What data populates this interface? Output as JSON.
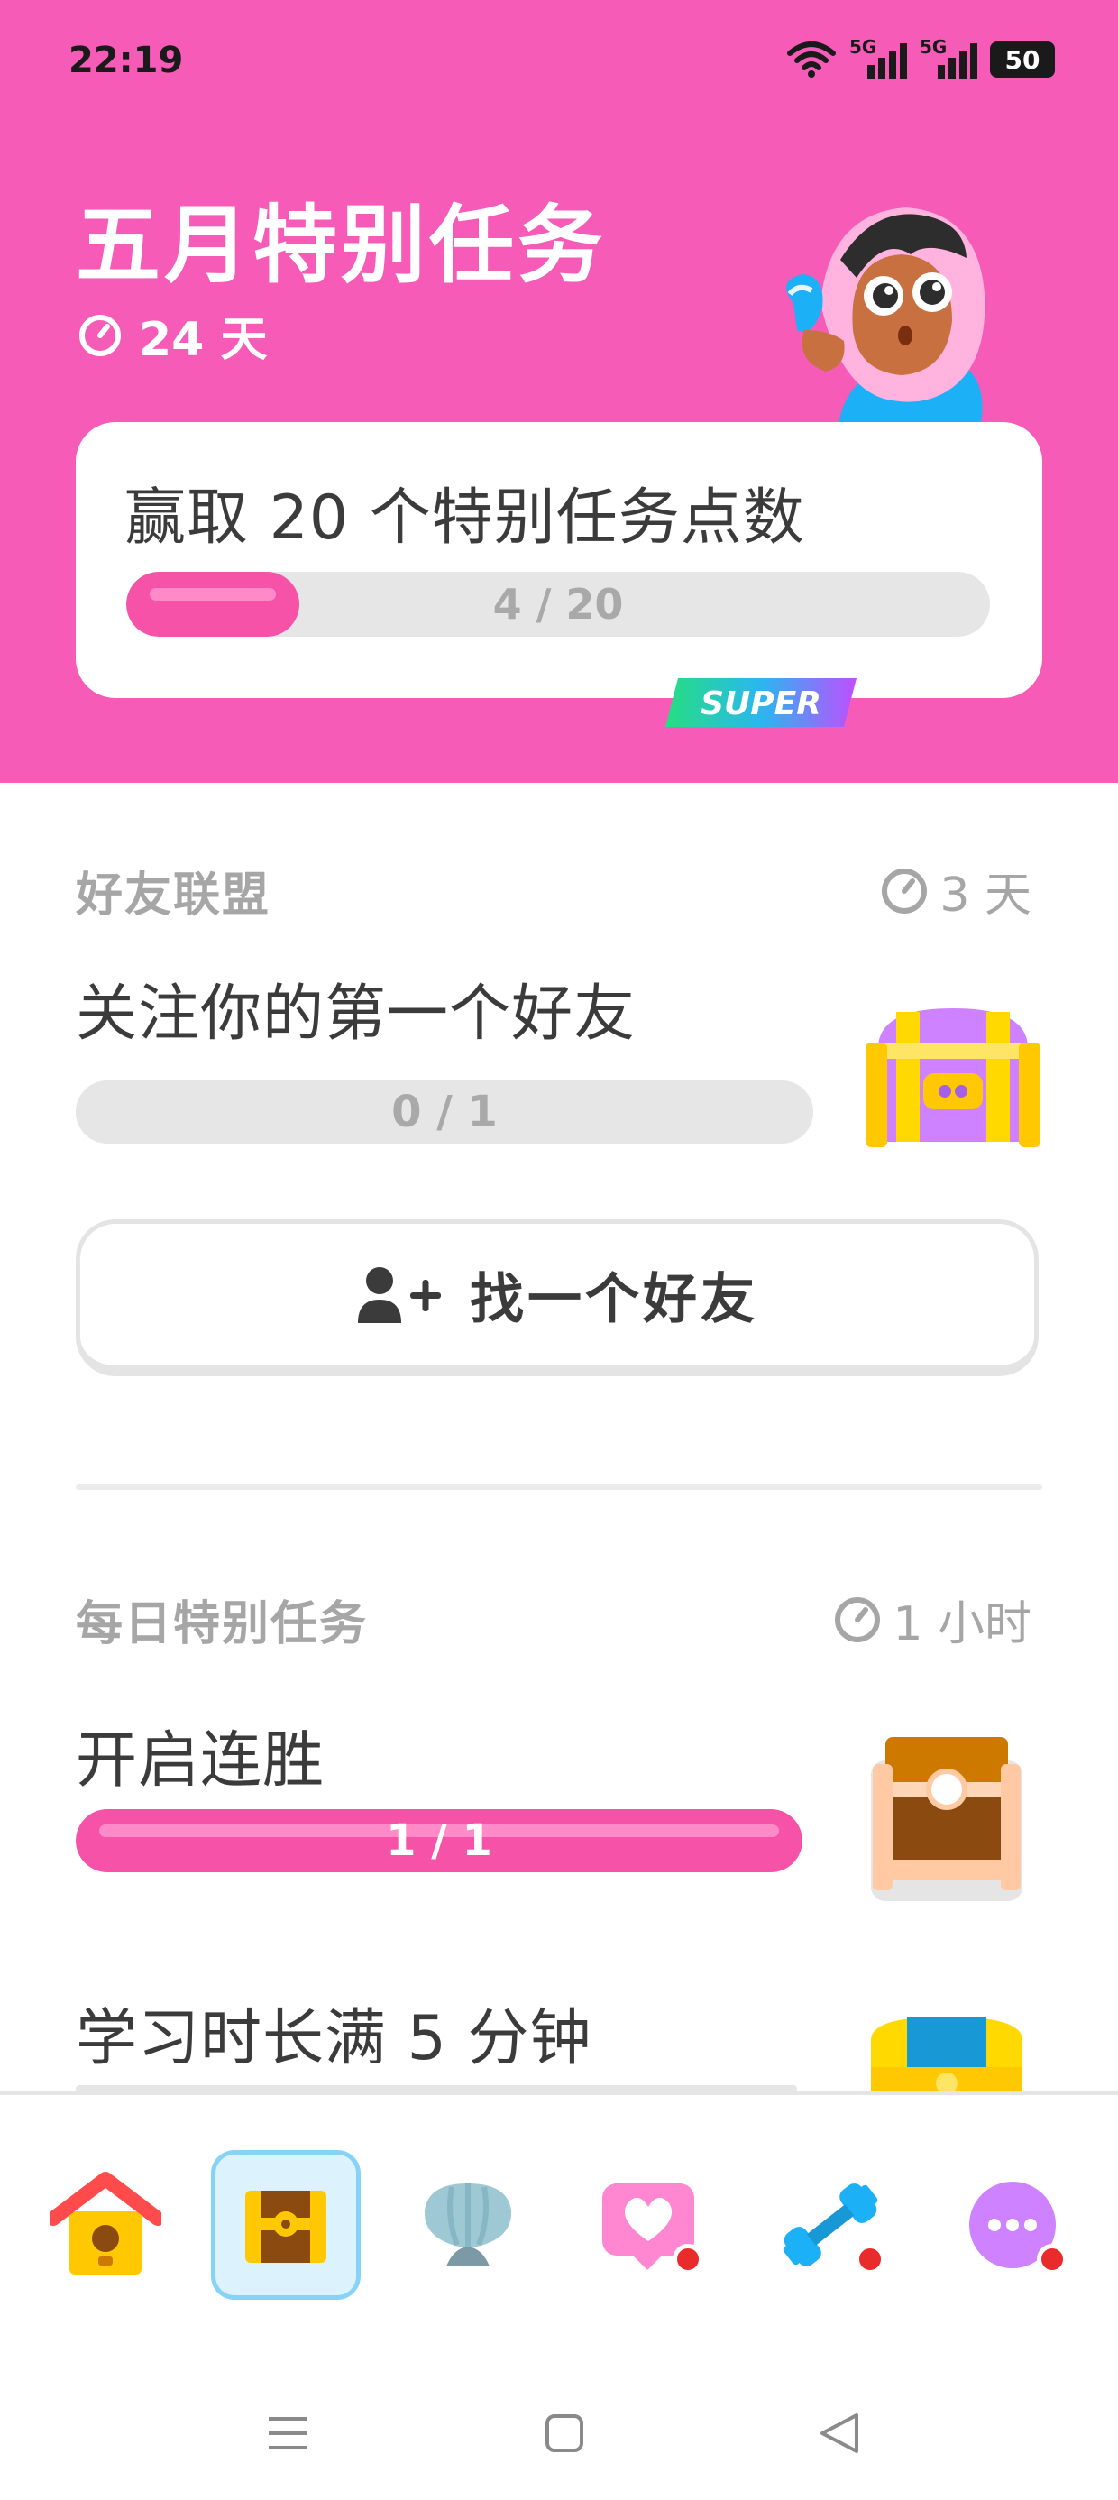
{
  "status_bar": {
    "time": "22:19",
    "signal1": "5G",
    "signal2": "5G",
    "battery": "50"
  },
  "header": {
    "title": "五月特别任务",
    "days_left": "24 天",
    "goal": "赢取 20 个特别任务点数",
    "progress_label": "4 / 20",
    "progress_fraction": 0.2,
    "badge": "SUPER"
  },
  "friends_quest": {
    "section_title": "好友联盟",
    "time_left": "3 天",
    "task": "关注你的第一个好友",
    "progress_label": "0 / 1",
    "progress_fraction": 0,
    "button_label": "找一个好友"
  },
  "daily_quests": {
    "section_title": "每日特别任务",
    "time_left": "1 小时",
    "items": [
      {
        "task": "开启连胜",
        "progress_label": "1 / 1",
        "progress_fraction": 1
      },
      {
        "task": "学习时长满 5 分钟",
        "progress_label": "",
        "progress_fraction": 0
      }
    ]
  },
  "bottom_nav": {
    "items": [
      {
        "icon": "home-icon",
        "active": false,
        "badge": false
      },
      {
        "icon": "quests-icon",
        "active": true,
        "badge": false
      },
      {
        "icon": "leaderboard-shell-icon",
        "active": false,
        "badge": false
      },
      {
        "icon": "hearts-icon",
        "active": false,
        "badge": true
      },
      {
        "icon": "practice-icon",
        "active": false,
        "badge": true
      },
      {
        "icon": "more-icon",
        "active": false,
        "badge": true
      }
    ]
  },
  "colors": {
    "header_bg": "#f55bb7",
    "progress_fill": "#f552a8",
    "active_nav_bg": "#dcf2fd"
  }
}
